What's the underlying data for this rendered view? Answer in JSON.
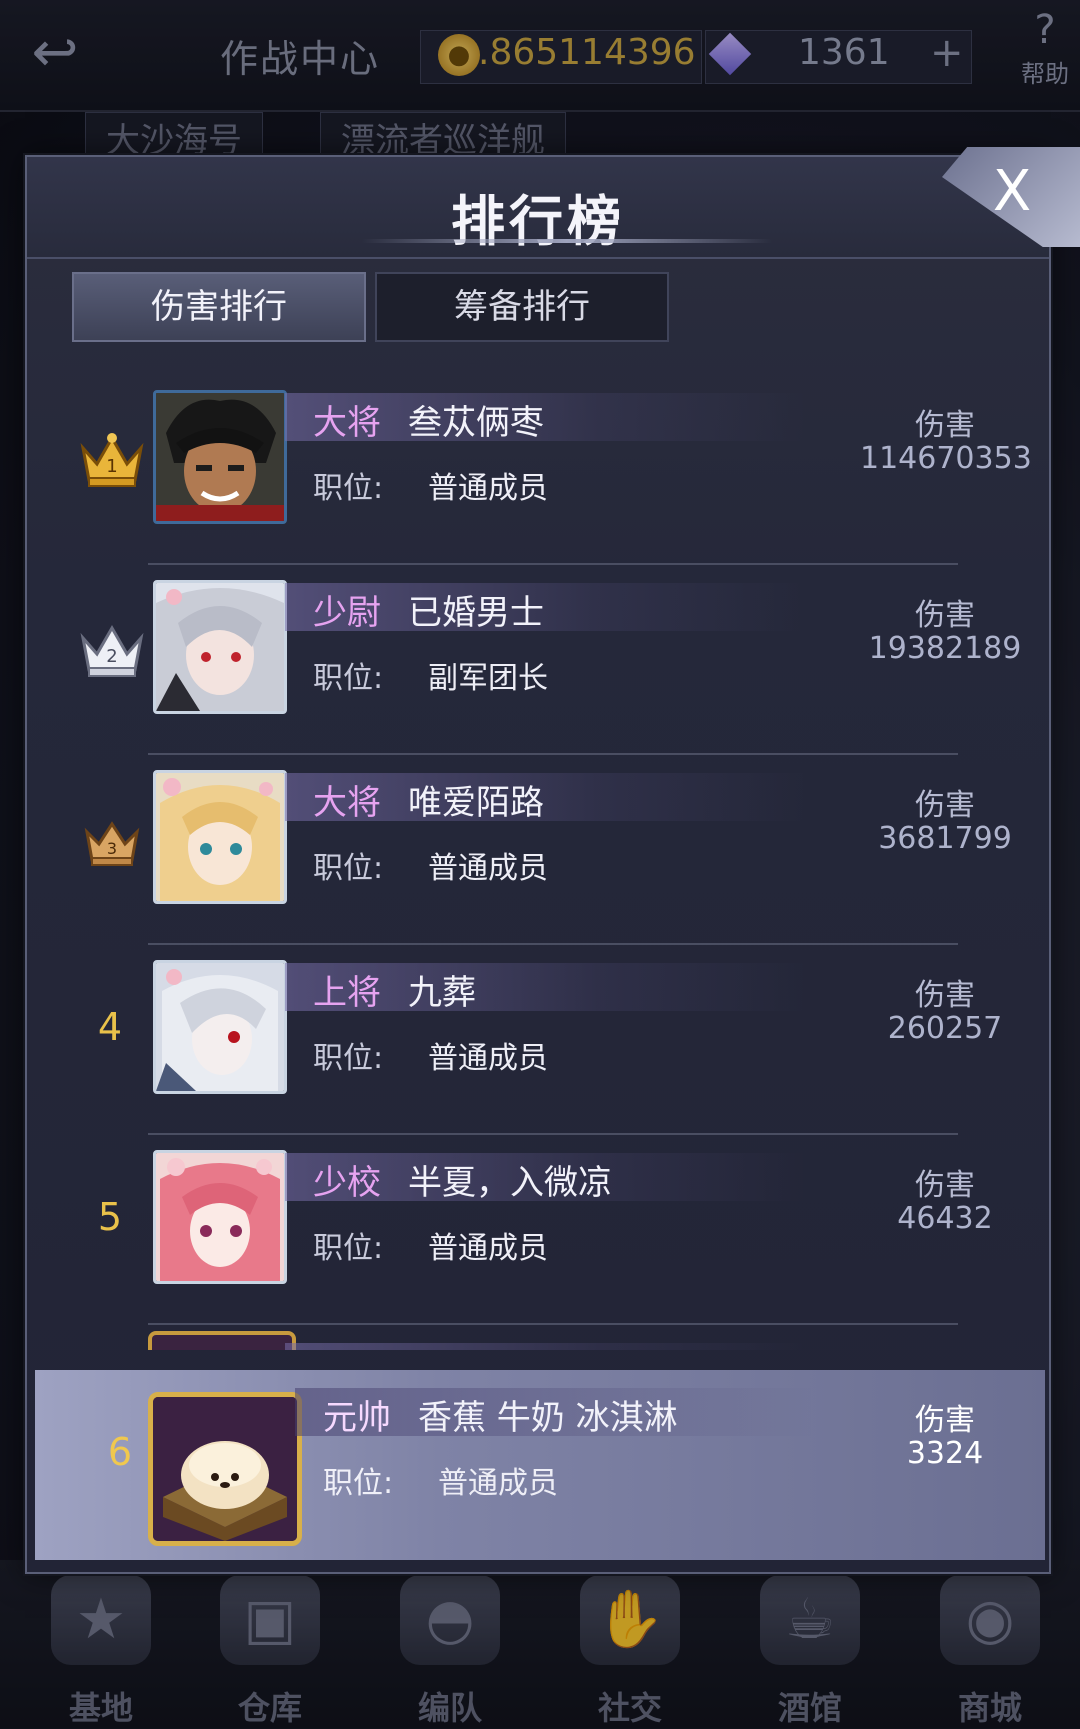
{
  "topbar": {
    "back_icon": "back-arrow-icon",
    "title": "作战中心",
    "coins": ".865114396",
    "gems": "1361",
    "plus": "+",
    "help_mark": "?",
    "help_label": "帮助"
  },
  "background_tabs": [
    "大沙海号",
    "漂流者巡洋舰"
  ],
  "modal": {
    "title": "排行榜",
    "close_label": "X",
    "tabs": [
      {
        "label": "伤害排行",
        "active": true
      },
      {
        "label": "筹备排行",
        "active": false
      }
    ]
  },
  "ranking": {
    "position_label": "职位:",
    "damage_label": "伤害",
    "rows": [
      {
        "rank": "1",
        "rank_icon": "gold-crown-icon",
        "title": "大将",
        "name": "叁苁俩枣",
        "position": "普通成员",
        "damage": "114670353"
      },
      {
        "rank": "2",
        "rank_icon": "silver-crown-icon",
        "title": "少尉",
        "name": "已婚男士",
        "position": "副军团长",
        "damage": "19382189"
      },
      {
        "rank": "3",
        "rank_icon": "bronze-crown-icon",
        "title": "大将",
        "name": "唯爱陌路",
        "position": "普通成员",
        "damage": "3681799"
      },
      {
        "rank": "4",
        "rank_icon": "",
        "title": "上将",
        "name": "九葬",
        "position": "普通成员",
        "damage": "260257"
      },
      {
        "rank": "5",
        "rank_icon": "",
        "title": "少校",
        "name": "半夏，入微凉",
        "position": "普通成员",
        "damage": "46432"
      }
    ],
    "self": {
      "rank": "6",
      "title": "元帅",
      "name": "香蕉 牛奶 冰淇淋",
      "position": "普通成员",
      "damage": "3324"
    }
  },
  "bottom_nav": [
    {
      "label": "基地",
      "icon": "star-badge-icon"
    },
    {
      "label": "仓库",
      "icon": "warehouse-icon"
    },
    {
      "label": "编队",
      "icon": "helmet-icon"
    },
    {
      "label": "社交",
      "icon": "handshake-icon"
    },
    {
      "label": "酒馆",
      "icon": "tavern-icon"
    },
    {
      "label": "商城",
      "icon": "shop-icon"
    }
  ]
}
